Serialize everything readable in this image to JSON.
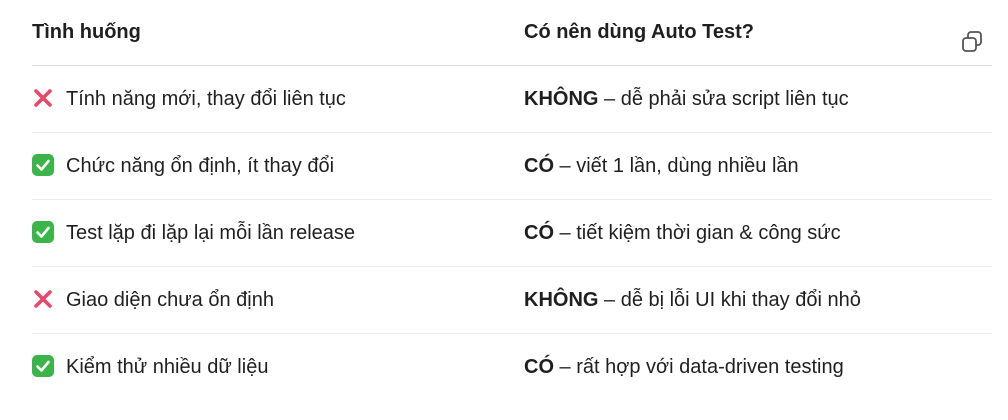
{
  "table": {
    "headers": [
      "Tình huống",
      "Có nên dùng Auto Test?"
    ],
    "rows": [
      {
        "icon": "cross-mark-icon",
        "situation": "Tính năng mới, thay đổi liên tục",
        "verdict": "KHÔNG",
        "note": " – dễ phải sửa script liên tục"
      },
      {
        "icon": "check-mark-icon",
        "situation": "Chức năng ổn định, ít thay đổi",
        "verdict": "CÓ",
        "note": " – viết 1 lần, dùng nhiều lần"
      },
      {
        "icon": "check-mark-icon",
        "situation": "Test lặp đi lặp lại mỗi lần release",
        "verdict": "CÓ",
        "note": " – tiết kiệm thời gian & công sức"
      },
      {
        "icon": "cross-mark-icon",
        "situation": "Giao diện chưa ổn định",
        "verdict": "KHÔNG",
        "note": " – dễ bị lỗi UI khi thay đổi nhỏ"
      },
      {
        "icon": "check-mark-icon",
        "situation": "Kiểm thử nhiều dữ liệu",
        "verdict": "CÓ",
        "note": " – rất hợp với data-driven testing"
      }
    ]
  },
  "colors": {
    "check": "#3bb54a",
    "cross": "#e8486a"
  }
}
